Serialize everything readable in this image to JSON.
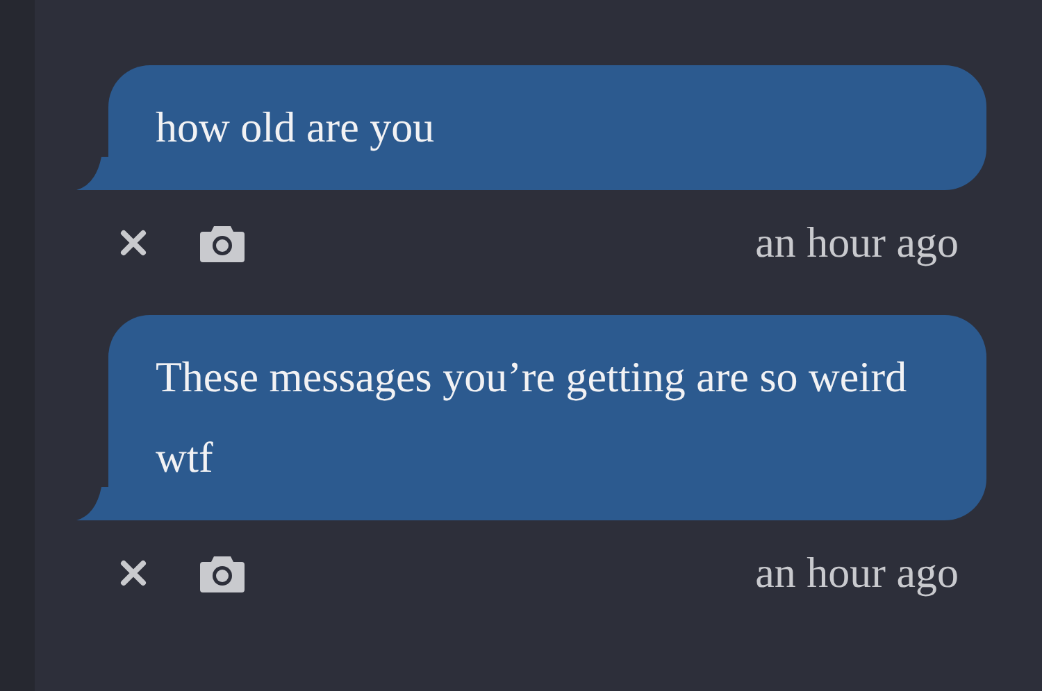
{
  "messages": [
    {
      "text": "how old are you",
      "time": "an hour ago"
    },
    {
      "text": "These messages you’re getting are so weird wtf",
      "time": "an hour ago"
    }
  ]
}
